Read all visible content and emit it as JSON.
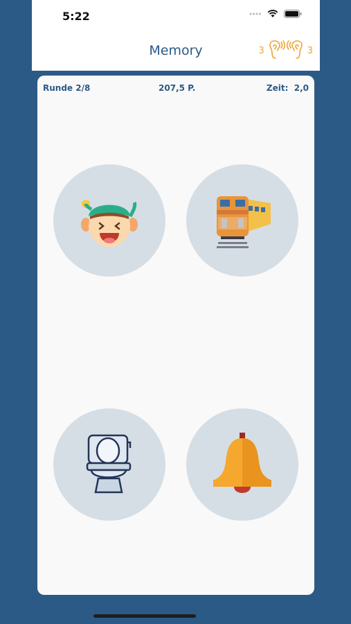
{
  "status_bar": {
    "time": "5:22"
  },
  "header": {
    "title": "Memory",
    "hearing_left_count": "3",
    "hearing_right_count": "3"
  },
  "stats": {
    "round": "Runde 2/8",
    "points": "207,5 P.",
    "time_label": "Zeit:",
    "time_value": "2,0"
  },
  "tiles": [
    {
      "icon": "elf-face-icon"
    },
    {
      "icon": "train-icon"
    },
    {
      "icon": "toilet-icon"
    },
    {
      "icon": "bell-icon"
    }
  ],
  "colors": {
    "background": "#2c5a86",
    "accent": "#f0a232",
    "tile": "#d5dee5",
    "card": "#f9f9f9"
  }
}
